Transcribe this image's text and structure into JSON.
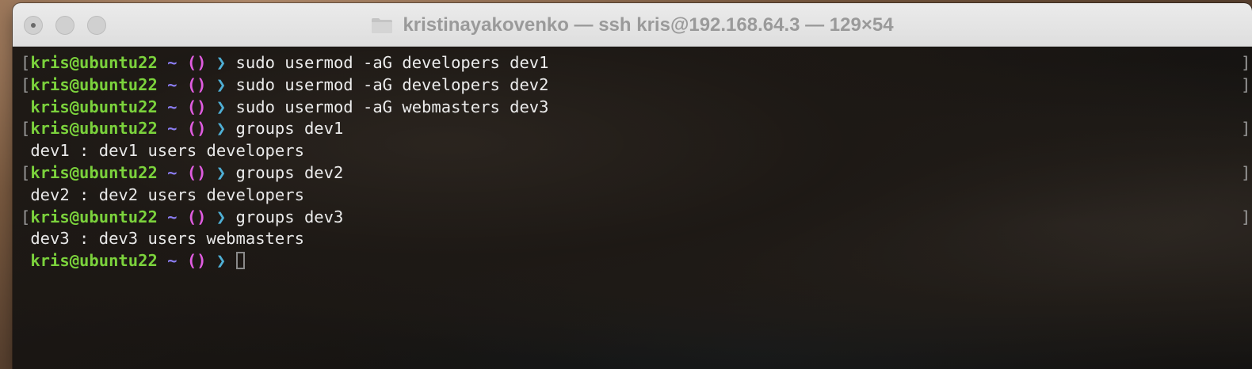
{
  "window": {
    "title": "kristinayakovenko — ssh kris@192.168.64.3 — 129×54",
    "folder_icon": "folder-icon"
  },
  "terminal": {
    "prompt": {
      "user_host": "kris@ubuntu22",
      "dir": "~",
      "git_symbol": "()",
      "chevron": "❯"
    },
    "lines": [
      {
        "type": "cmd",
        "bracket": true,
        "text": "sudo usermod -aG developers dev1"
      },
      {
        "type": "cmd",
        "bracket": true,
        "text": "sudo usermod -aG developers dev2"
      },
      {
        "type": "cmd",
        "bracket": false,
        "text": "sudo usermod -aG webmasters dev3"
      },
      {
        "type": "cmd",
        "bracket": true,
        "text": "groups dev1"
      },
      {
        "type": "out",
        "text": "dev1 : dev1 users developers"
      },
      {
        "type": "cmd",
        "bracket": true,
        "text": "groups dev2"
      },
      {
        "type": "out",
        "text": "dev2 : dev2 users developers"
      },
      {
        "type": "cmd",
        "bracket": true,
        "text": "groups dev3"
      },
      {
        "type": "out",
        "text": "dev3 : dev3 users webmasters"
      },
      {
        "type": "cmd",
        "bracket": false,
        "text": ""
      }
    ]
  },
  "colors": {
    "user": "#7bd23c",
    "tilde": "#8a7cf0",
    "git": "#e05ce0",
    "chevron": "#4fb0d6"
  }
}
